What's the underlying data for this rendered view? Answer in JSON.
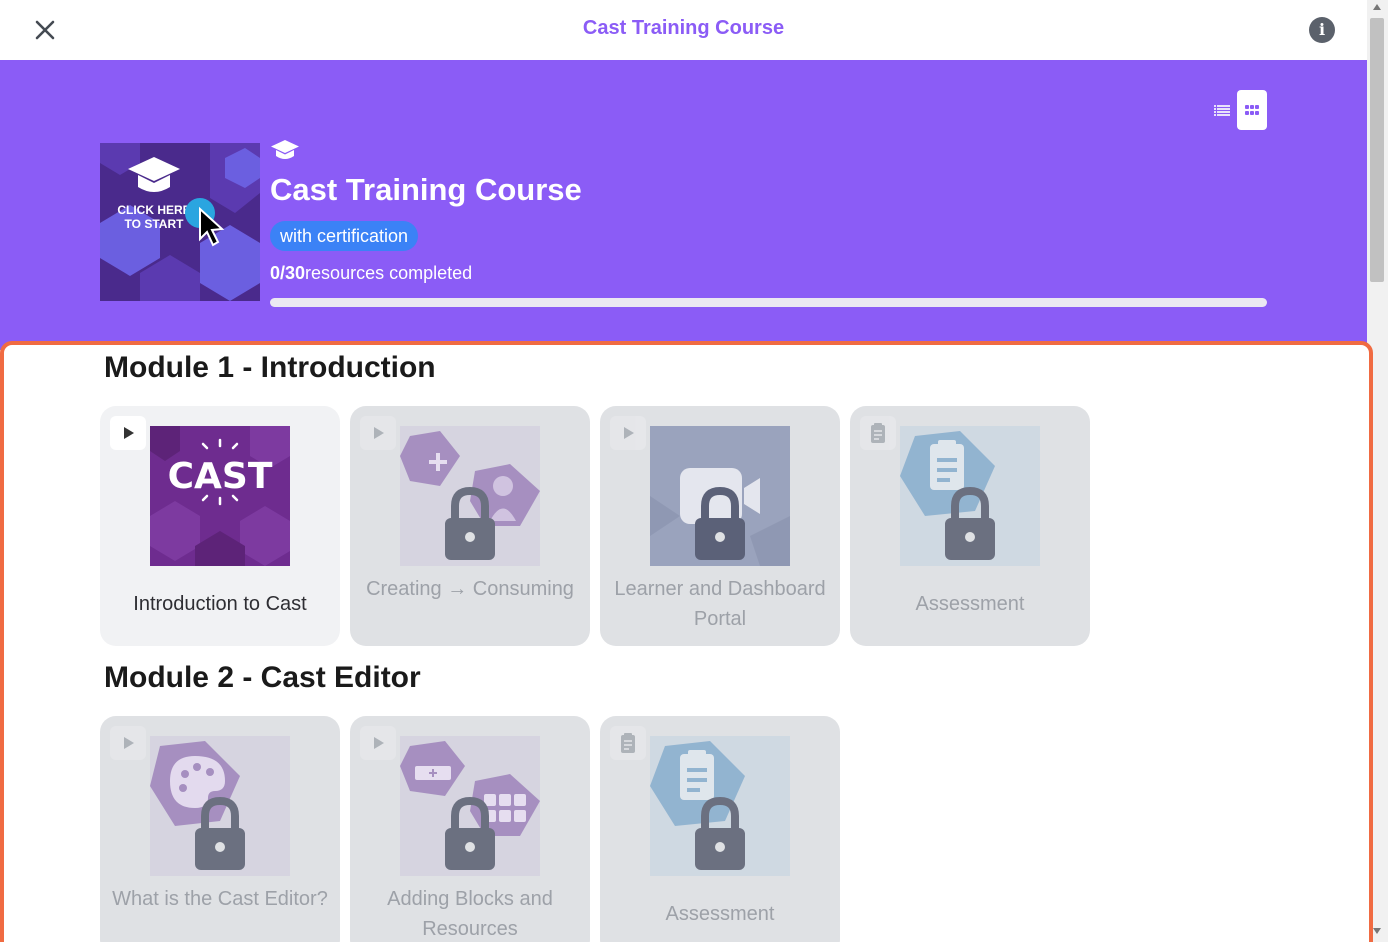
{
  "topbar": {
    "title": "Cast Training Course"
  },
  "hero": {
    "thumbnail_text": "CLICK HERE TO START",
    "title": "Cast Training Course",
    "badge": "with certification",
    "progress_count": "0/30",
    "progress_label": "resources completed",
    "progress_fraction": 0
  },
  "modules": [
    {
      "title": "Module 1 - Introduction",
      "cards": [
        {
          "label": "Introduction to Cast",
          "type": "video",
          "locked": false,
          "image_text": "CAST"
        },
        {
          "label": "Creating → Consuming",
          "type": "video",
          "locked": true
        },
        {
          "label": "Learner and Dashboard Portal",
          "type": "video",
          "locked": true
        },
        {
          "label": "Assessment",
          "type": "assessment",
          "locked": true
        }
      ]
    },
    {
      "title": "Module 2 - Cast Editor",
      "cards": [
        {
          "label": "What is the Cast Editor?",
          "type": "video",
          "locked": true
        },
        {
          "label": "Adding Blocks and Resources",
          "type": "video",
          "locked": true
        },
        {
          "label": "Assessment",
          "type": "assessment",
          "locked": true
        }
      ]
    }
  ],
  "colors": {
    "brand_purple": "#8b5cf6",
    "accent_blue": "#3b82f6",
    "focus_border": "#f06b42"
  },
  "icons": {
    "close": "close-icon",
    "info": "info-icon",
    "list_view": "list-view-icon",
    "grid_view": "grid-view-icon",
    "course": "graduation-cap-icon",
    "video": "play-icon",
    "assessment": "clipboard-icon",
    "locked": "lock-icon"
  }
}
